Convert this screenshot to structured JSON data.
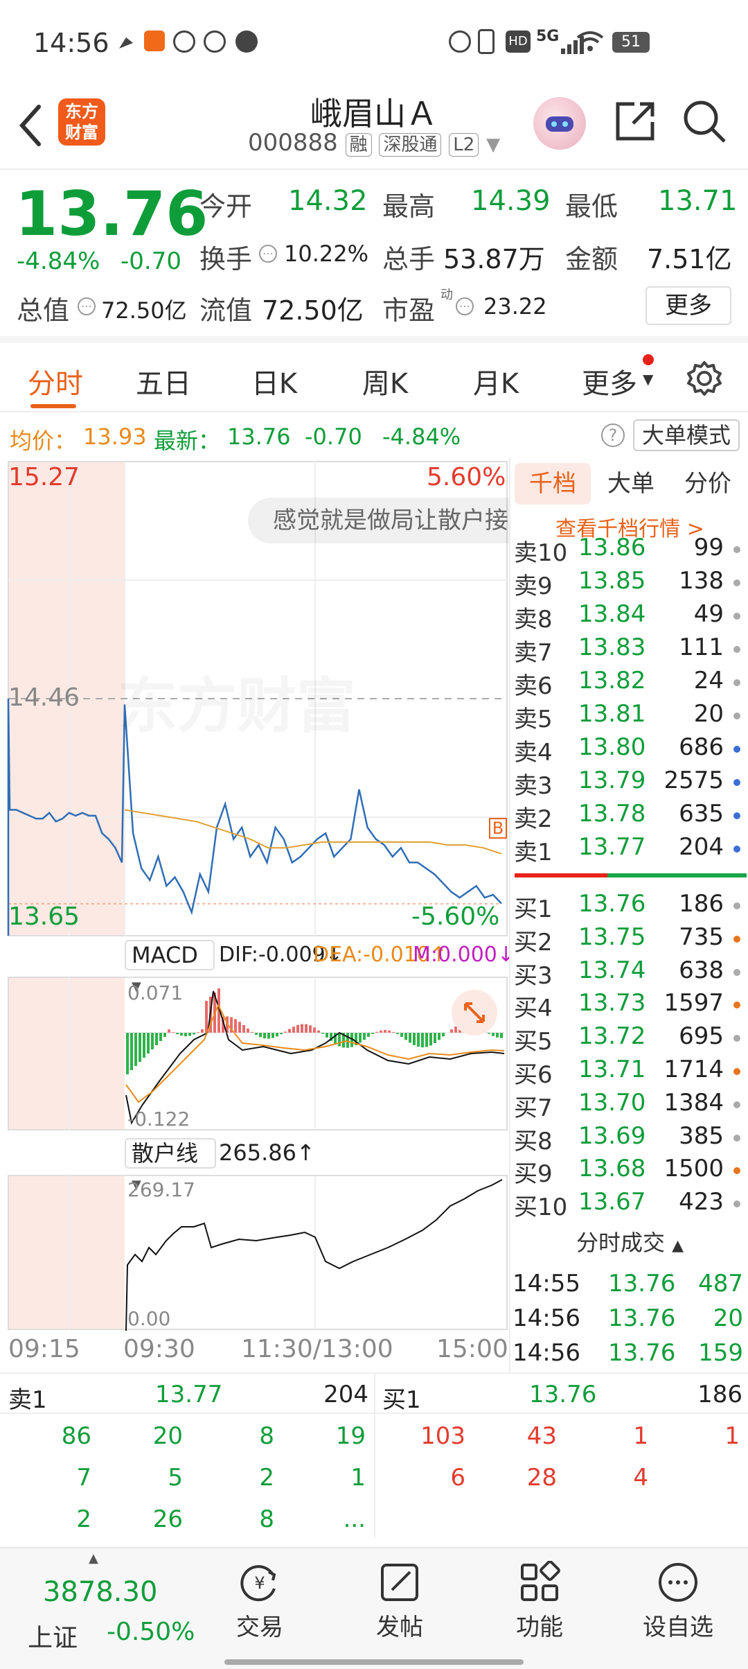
{
  "status": {
    "time": "14:56",
    "battery": "51",
    "network": "5G"
  },
  "header": {
    "logo_line1": "东方",
    "logo_line2": "财富",
    "stock_name": "峨眉山Ａ",
    "stock_code": "000888",
    "tags": [
      "融",
      "深股通",
      "L2"
    ]
  },
  "quote": {
    "price": "13.76",
    "change_pct": "-4.84%",
    "change": "-0.70",
    "open_label": "今开",
    "open": "14.32",
    "high_label": "最高",
    "high": "14.39",
    "low_label": "最低",
    "low": "13.71",
    "turnover_label": "换手",
    "turnover": "10.22%",
    "volume_label": "总手",
    "volume": "53.87万",
    "amount_label": "金额",
    "amount": "7.51亿",
    "mktcap_label": "总值",
    "mktcap": "72.50亿",
    "float_label": "流值",
    "float": "72.50亿",
    "pe_label": "市盈",
    "pe_sup": "动",
    "pe": "23.22",
    "more": "更多"
  },
  "tabs": [
    "分时",
    "五日",
    "日K",
    "周K",
    "月K",
    "更多"
  ],
  "infobar": {
    "avg_label": "均价：",
    "avg": "13.93",
    "latest_label": "最新：",
    "latest": "13.76",
    "chg": "-0.70",
    "pct": "-4.84%",
    "mode": "大单模式"
  },
  "chart": {
    "high": "15.27",
    "high_pct": "5.60%",
    "mid": "14.46",
    "low": "13.65",
    "low_pct": "-5.60%",
    "comment": "感觉就是做局让散户接",
    "watermark": "东方财富",
    "marker": "B",
    "macd_label": "MACD",
    "dif": "DIF:-0.009↓",
    "dea": "DEA:-0.010↑",
    "m": "M:0.000↓",
    "macd_top": "0.071",
    "macd_bottom": "-0.122",
    "retail_label": "散户线",
    "retail_val": "265.86↑",
    "retail_top": "269.17",
    "retail_bottom": "0.00",
    "times": [
      "09:15",
      "09:30",
      "11:30/13:00",
      "15:00"
    ]
  },
  "chart_data": {
    "type": "line",
    "series": [
      {
        "values": [
          14.46,
          14.08,
          14.08,
          14.07,
          14.06,
          14.05,
          14.05,
          14.07,
          14.04,
          14.05,
          14.07,
          14.06,
          14.07,
          14.06,
          14.06,
          14.0,
          13.98,
          13.95,
          13.9,
          14.44,
          14.0,
          13.88,
          13.84,
          13.92,
          13.82,
          13.85,
          13.8,
          13.73,
          13.86,
          13.8,
          14.02,
          14.1,
          13.98,
          14.02,
          13.92,
          13.96,
          13.9,
          14.02,
          13.98,
          13.9,
          13.92,
          13.95,
          13.98,
          14.0,
          13.92,
          13.95,
          13.98,
          14.15,
          14.02,
          13.98,
          13.96,
          13.92,
          13.95,
          13.9,
          13.9,
          13.88,
          13.86,
          13.83,
          13.8,
          13.78,
          13.8,
          13.82,
          13.78,
          13.79,
          13.76
        ]
      },
      {
        "values": [
          14.46,
          14.08,
          14.07,
          14.06,
          14.05,
          14.04,
          14.02,
          14.0,
          13.98,
          13.95,
          13.95,
          13.96,
          13.97,
          13.97,
          13.97,
          13.97,
          13.97,
          13.97,
          13.97,
          13.96,
          13.96,
          13.95,
          13.93
        ]
      }
    ],
    "ylim": [
      13.65,
      15.27
    ],
    "x": [
      "09:15",
      "09:30",
      "11:30/13:00",
      "15:00"
    ]
  },
  "depth": {
    "tabs": [
      "千档",
      "大单",
      "分价"
    ],
    "link": "查看千档行情 >",
    "asks": [
      {
        "label": "卖10",
        "price": "13.86",
        "vol": "99",
        "dot": "#aaaaaa"
      },
      {
        "label": "卖9",
        "price": "13.85",
        "vol": "138",
        "dot": "#aaaaaa"
      },
      {
        "label": "卖8",
        "price": "13.84",
        "vol": "49",
        "dot": "#aaaaaa"
      },
      {
        "label": "卖7",
        "price": "13.83",
        "vol": "111",
        "dot": "#aaaaaa"
      },
      {
        "label": "卖6",
        "price": "13.82",
        "vol": "24",
        "dot": "#aaaaaa"
      },
      {
        "label": "卖5",
        "price": "13.81",
        "vol": "20",
        "dot": "#aaaaaa"
      },
      {
        "label": "卖4",
        "price": "13.80",
        "vol": "686",
        "dot": "#3a6fd6"
      },
      {
        "label": "卖3",
        "price": "13.79",
        "vol": "2575",
        "dot": "#3a6fd6"
      },
      {
        "label": "卖2",
        "price": "13.78",
        "vol": "635",
        "dot": "#3a6fd6"
      },
      {
        "label": "卖1",
        "price": "13.77",
        "vol": "204",
        "dot": "#3a6fd6"
      }
    ],
    "bids": [
      {
        "label": "买1",
        "price": "13.76",
        "vol": "186",
        "dot": "#aaaaaa"
      },
      {
        "label": "买2",
        "price": "13.75",
        "vol": "735",
        "dot": "#e8741c"
      },
      {
        "label": "买3",
        "price": "13.74",
        "vol": "638",
        "dot": "#aaaaaa"
      },
      {
        "label": "买4",
        "price": "13.73",
        "vol": "1597",
        "dot": "#e8741c"
      },
      {
        "label": "买5",
        "price": "13.72",
        "vol": "695",
        "dot": "#aaaaaa"
      },
      {
        "label": "买6",
        "price": "13.71",
        "vol": "1714",
        "dot": "#e8741c"
      },
      {
        "label": "买7",
        "price": "13.70",
        "vol": "1384",
        "dot": "#aaaaaa"
      },
      {
        "label": "买8",
        "price": "13.69",
        "vol": "385",
        "dot": "#aaaaaa"
      },
      {
        "label": "买9",
        "price": "13.68",
        "vol": "1500",
        "dot": "#e8741c"
      },
      {
        "label": "买10",
        "price": "13.67",
        "vol": "423",
        "dot": "#aaaaaa"
      }
    ],
    "ticks_label": "分时成交",
    "ticks": [
      {
        "time": "14:55",
        "price": "13.76",
        "vol": "487"
      },
      {
        "time": "14:56",
        "price": "13.76",
        "vol": "20"
      },
      {
        "time": "14:56",
        "price": "13.76",
        "vol": "159"
      }
    ]
  },
  "queue": {
    "sell_label": "卖1",
    "sell_price": "13.77",
    "sell_vol": "204",
    "buy_label": "买1",
    "buy_price": "13.76",
    "buy_vol": "186",
    "sell_rows": [
      [
        "86",
        "20",
        "8",
        "19"
      ],
      [
        "7",
        "5",
        "2",
        "1"
      ],
      [
        "2",
        "26",
        "8",
        "..."
      ]
    ],
    "buy_rows": [
      [
        "103",
        "43",
        "1",
        "1"
      ],
      [
        "6",
        "28",
        "4",
        ""
      ]
    ]
  },
  "bottom": {
    "index_value": "3878.30",
    "index_name": "上证",
    "index_change": "-0.50%",
    "buttons": [
      "交易",
      "发帖",
      "功能",
      "设自选"
    ]
  }
}
